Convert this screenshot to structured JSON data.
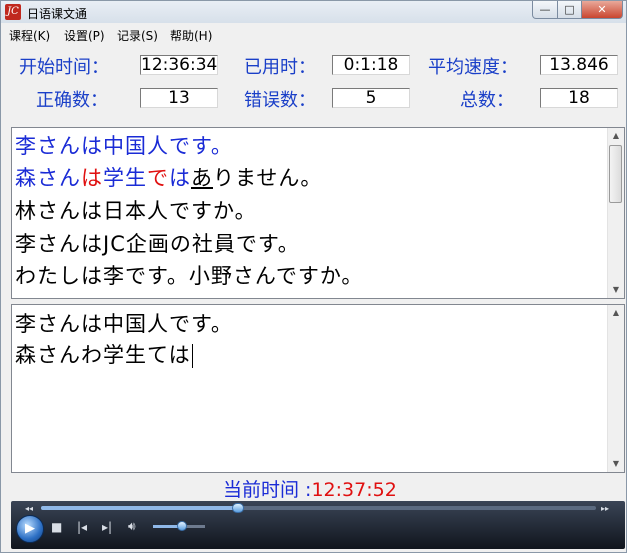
{
  "window": {
    "title": "日语课文通",
    "app_icon": "JC-logo-icon"
  },
  "menu": [
    {
      "label": "课程(K)"
    },
    {
      "label": "设置(P)"
    },
    {
      "label": "记录(S)"
    },
    {
      "label": "帮助(H)"
    }
  ],
  "stats": {
    "start_time_label": "开始时间：",
    "start_time": "12:36:34",
    "elapsed_label": "已用时：",
    "elapsed": "0:1:18",
    "avg_speed_label": "平均速度：",
    "avg_speed": "13.846",
    "correct_label": "正确数：",
    "correct": "13",
    "errors_label": "错误数：",
    "errors": "5",
    "total_label": "总数：",
    "total": "18"
  },
  "source_text": {
    "line1": "李さんは中国人です。",
    "line2": [
      {
        "text": "森さん",
        "color": "#1a2bd6"
      },
      {
        "text": "は",
        "color": "#e01010"
      },
      {
        "text": "学生",
        "color": "#1a2bd6"
      },
      {
        "text": "で",
        "color": "#e01010"
      },
      {
        "text": "は",
        "color": "#1a2bd6"
      },
      {
        "text": "あ",
        "color": "#000000",
        "underline": true
      },
      {
        "text": "りません。",
        "color": "#000000"
      }
    ],
    "line3": "林さんは日本人ですか。",
    "line4": "李さんはJC企画の社員です。",
    "line5": "わたしは李です。小野さんですか。"
  },
  "typed_text": {
    "line1": "李さんは中国人です。",
    "line2": "森さんわ学生ては"
  },
  "clock": {
    "label": "当前时间 :",
    "time": "12:37:52",
    "label_color": "#1a2bd6",
    "time_color": "#e01010"
  },
  "player": {
    "seek_progress": 0.355,
    "volume_level": 0.55,
    "icons": [
      "play-icon",
      "stop-icon",
      "previous-icon",
      "next-icon",
      "volume-icon"
    ]
  },
  "colors": {
    "correct": "#1a2bd6",
    "error": "#e01010",
    "label": "#1a3fc8"
  }
}
